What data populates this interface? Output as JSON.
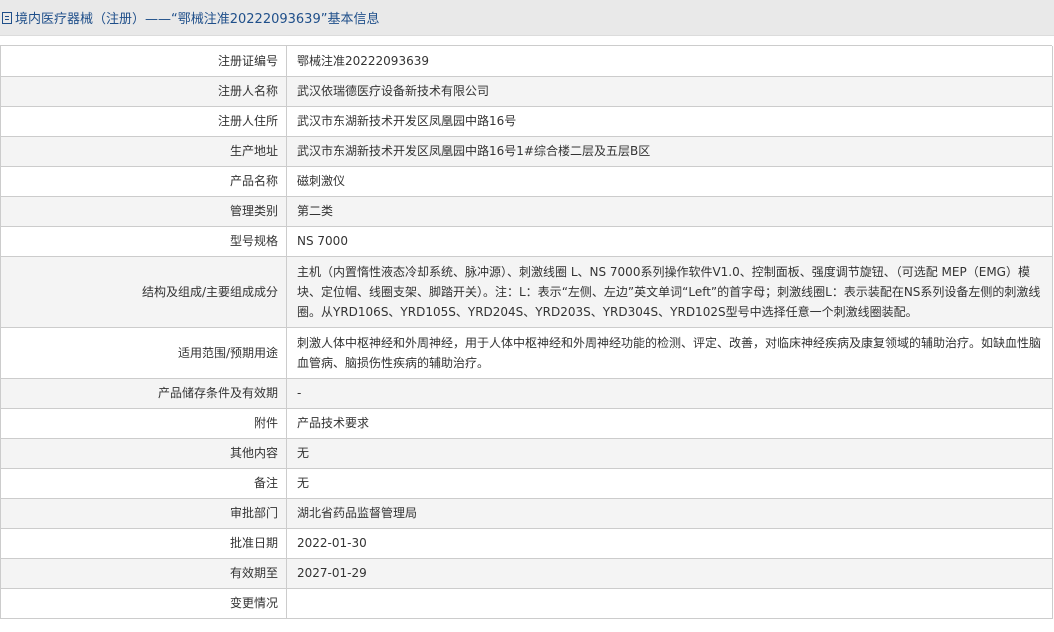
{
  "header": {
    "title": "境内医疗器械（注册）——“鄂械注准20222093639”基本信息",
    "icon": "document-icon",
    "title_color": "#1f4f8a"
  },
  "rows": [
    {
      "label": "注册证编号",
      "value": "鄂械注准20222093639"
    },
    {
      "label": "注册人名称",
      "value": "武汉依瑞德医疗设备新技术有限公司"
    },
    {
      "label": "注册人住所",
      "value": "武汉市东湖新技术开发区凤凰园中路16号"
    },
    {
      "label": "生产地址",
      "value": "武汉市东湖新技术开发区凤凰园中路16号1#综合楼二层及五层B区"
    },
    {
      "label": "产品名称",
      "value": "磁刺激仪"
    },
    {
      "label": "管理类别",
      "value": "第二类"
    },
    {
      "label": "型号规格",
      "value": "NS 7000"
    },
    {
      "label": "结构及组成/主要组成成分",
      "value": "主机（内置惰性液态冷却系统、脉冲源）、刺激线圈 L、NS 7000系列操作软件V1.0、控制面板、强度调节旋钮、（可选配 MEP（EMG）模块、定位帽、线圈支架、脚踏开关）。注：L：表示“左侧、左边”英文单词“Left”的首字母；刺激线圈L：表示装配在NS系列设备左侧的刺激线圈。从YRD106S、YRD105S、YRD204S、YRD203S、YRD304S、YRD102S型号中选择任意一个刺激线圈装配。"
    },
    {
      "label": "适用范围/预期用途",
      "value": "刺激人体中枢神经和外周神经，用于人体中枢神经和外周神经功能的检测、评定、改善，对临床神经疾病及康复领域的辅助治疗。如缺血性脑血管病、脑损伤性疾病的辅助治疗。"
    },
    {
      "label": "产品储存条件及有效期",
      "value": "-"
    },
    {
      "label": "附件",
      "value": "产品技术要求"
    },
    {
      "label": "其他内容",
      "value": "无"
    },
    {
      "label": "备注",
      "value": "无"
    },
    {
      "label": "审批部门",
      "value": "湖北省药品监督管理局"
    },
    {
      "label": "批准日期",
      "value": "2022-01-30"
    },
    {
      "label": "有效期至",
      "value": "2027-01-29"
    },
    {
      "label": "变更情况",
      "value": ""
    }
  ]
}
